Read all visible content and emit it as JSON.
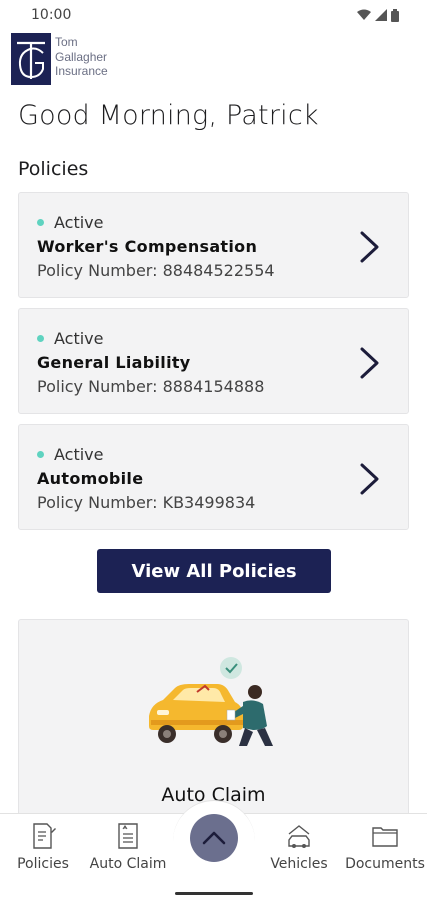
{
  "status_bar": {
    "time": "10:00"
  },
  "logo": {
    "line1": "Tom",
    "line2": "Gallagher",
    "line3": "Insurance"
  },
  "greeting": "Good Morning, Patrick",
  "policies_section": {
    "title": "Policies",
    "items": [
      {
        "status": "Active",
        "name": "Worker's Compensation",
        "number": "Policy Number: 88484522554"
      },
      {
        "status": "Active",
        "name": "General Liability",
        "number": "Policy Number: 8884154888"
      },
      {
        "status": "Active",
        "name": "Automobile",
        "number": "Policy Number: KB3499834"
      }
    ]
  },
  "view_all_label": "View All Policies",
  "auto_claim_card": {
    "label": "Auto Claim"
  },
  "bottom_nav": {
    "items": [
      {
        "label": "Policies",
        "icon": "policies-icon"
      },
      {
        "label": "Auto Claim",
        "icon": "auto-claim-icon"
      },
      {
        "label": "Vehicles",
        "icon": "vehicles-icon"
      },
      {
        "label": "Documents",
        "icon": "documents-icon"
      }
    ],
    "center_icon": "chevron-up-icon"
  },
  "colors": {
    "brand_navy": "#1c2254",
    "active_dot": "#5fd3c0",
    "card_bg": "#f3f3f4",
    "fab": "#6b6f8e"
  }
}
